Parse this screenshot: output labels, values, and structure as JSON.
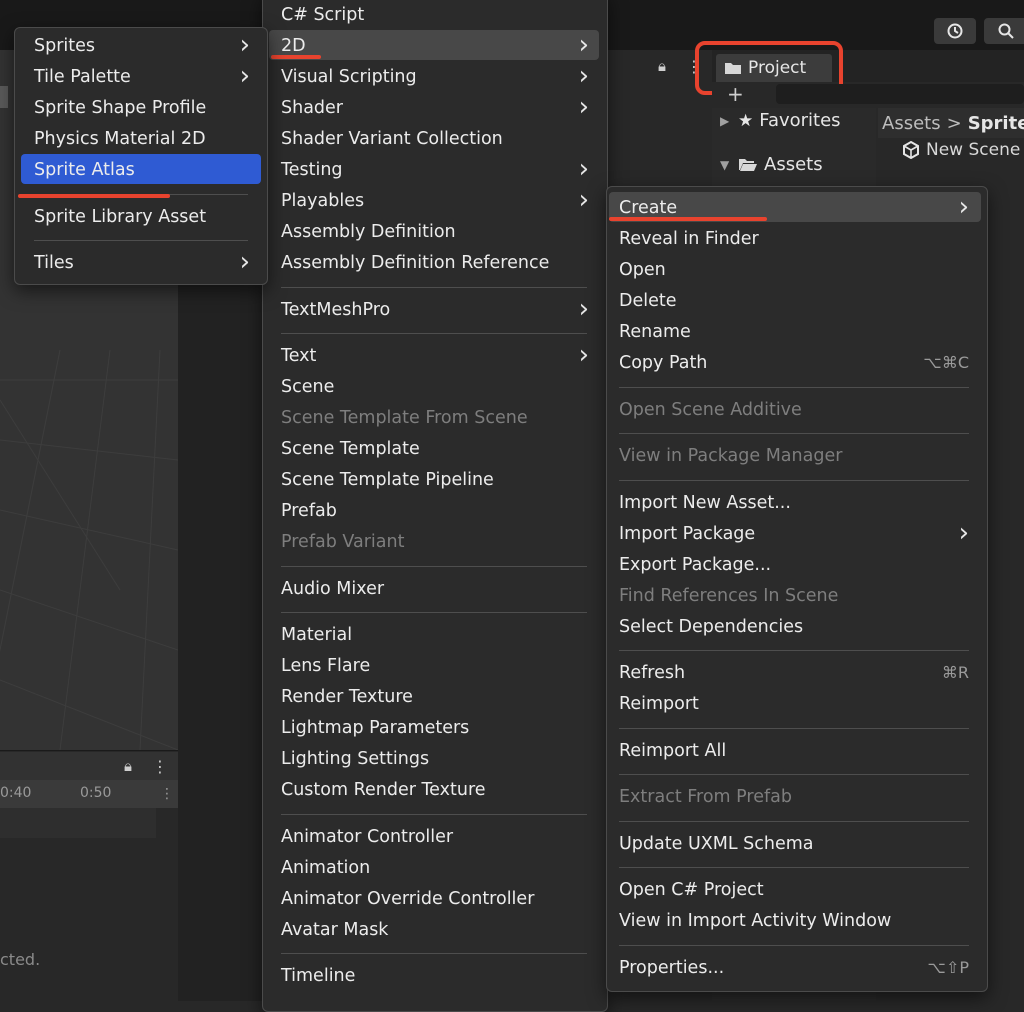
{
  "colors": {
    "accent_highlight": "#2f5bd3",
    "hover_highlight": "#484848",
    "annotation_red": "#e8432e",
    "menu_background": "#2b2b2b",
    "disabled_text": "#7e7e7e"
  },
  "editor": {
    "project_tab": "Project",
    "project_tab_icon": "folder-icon",
    "lock_icon": "lock-icon",
    "kebab_icon": "kebab-icon",
    "toolbar_icons": [
      "history-icon",
      "search-icon"
    ],
    "tree": {
      "favorites": "Favorites",
      "assets": "Assets"
    },
    "breadcrumb": {
      "root": "Assets",
      "separator": ">",
      "current": "SpriteA"
    },
    "new_scene": "New Scene",
    "timeline_ticks": [
      "0:40",
      "0:50"
    ],
    "status_text": "cted."
  },
  "menu_2d": {
    "items": [
      {
        "label": "Sprites",
        "submenu": true
      },
      {
        "label": "Tile Palette",
        "submenu": true
      },
      {
        "label": "Sprite Shape Profile",
        "submenu": false
      },
      {
        "label": "Physics Material 2D",
        "submenu": false
      },
      {
        "label": "Sprite Atlas",
        "submenu": false,
        "selected": true
      },
      {
        "label": "Sprite Library Asset",
        "submenu": false
      },
      {
        "label": "Tiles",
        "submenu": true
      }
    ]
  },
  "menu_create": {
    "items": [
      {
        "label": "C# Script"
      },
      {
        "label": "2D",
        "submenu": true,
        "hovered": true
      },
      {
        "label": "Visual Scripting",
        "submenu": true
      },
      {
        "label": "Shader",
        "submenu": true
      },
      {
        "label": "Shader Variant Collection"
      },
      {
        "label": "Testing",
        "submenu": true
      },
      {
        "label": "Playables",
        "submenu": true
      },
      {
        "label": "Assembly Definition"
      },
      {
        "label": "Assembly Definition Reference"
      },
      {
        "label": "TextMeshPro",
        "submenu": true
      },
      {
        "label": "Text",
        "submenu": true
      },
      {
        "label": "Scene"
      },
      {
        "label": "Scene Template From Scene",
        "disabled": true
      },
      {
        "label": "Scene Template"
      },
      {
        "label": "Scene Template Pipeline"
      },
      {
        "label": "Prefab"
      },
      {
        "label": "Prefab Variant",
        "disabled": true
      },
      {
        "label": "Audio Mixer"
      },
      {
        "label": "Material"
      },
      {
        "label": "Lens Flare"
      },
      {
        "label": "Render Texture"
      },
      {
        "label": "Lightmap Parameters"
      },
      {
        "label": "Lighting Settings"
      },
      {
        "label": "Custom Render Texture"
      },
      {
        "label": "Animator Controller"
      },
      {
        "label": "Animation"
      },
      {
        "label": "Animator Override Controller"
      },
      {
        "label": "Avatar Mask"
      },
      {
        "label": "Timeline"
      }
    ]
  },
  "menu_context": {
    "items": [
      {
        "label": "Create",
        "submenu": true,
        "hovered": true
      },
      {
        "label": "Reveal in Finder"
      },
      {
        "label": "Open"
      },
      {
        "label": "Delete"
      },
      {
        "label": "Rename"
      },
      {
        "label": "Copy Path",
        "shortcut": "⌥⌘C"
      },
      {
        "label": "Open Scene Additive",
        "disabled": true
      },
      {
        "label": "View in Package Manager",
        "disabled": true
      },
      {
        "label": "Import New Asset..."
      },
      {
        "label": "Import Package",
        "submenu": true
      },
      {
        "label": "Export Package..."
      },
      {
        "label": "Find References In Scene",
        "disabled": true
      },
      {
        "label": "Select Dependencies"
      },
      {
        "label": "Refresh",
        "shortcut": "⌘R"
      },
      {
        "label": "Reimport"
      },
      {
        "label": "Reimport All"
      },
      {
        "label": "Extract From Prefab",
        "disabled": true
      },
      {
        "label": "Update UXML Schema"
      },
      {
        "label": "Open C# Project"
      },
      {
        "label": "View in Import Activity Window"
      },
      {
        "label": "Properties...",
        "shortcut": "⌥⇧P"
      }
    ]
  }
}
